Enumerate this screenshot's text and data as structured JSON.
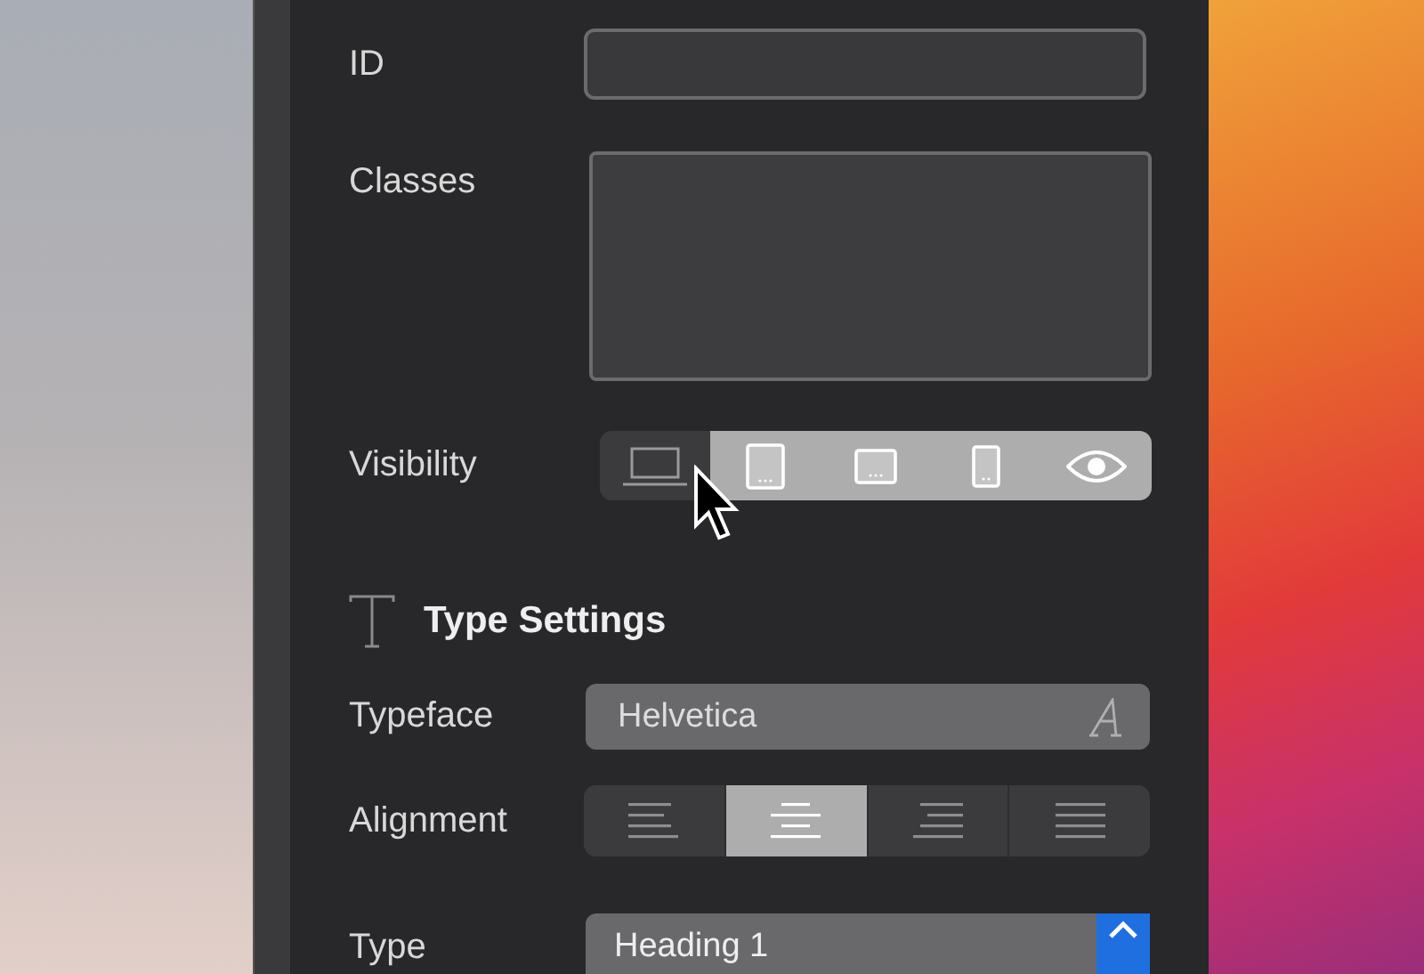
{
  "fields": [
    {
      "label": "ID",
      "kind": "input"
    },
    {
      "label": "Classes",
      "kind": "textarea"
    }
  ],
  "visibility": {
    "label": "Visibility",
    "devices": [
      {
        "kind": "laptop",
        "on": false
      },
      {
        "kind": "tablet",
        "on": true
      },
      {
        "kind": "landscape",
        "on": true
      },
      {
        "kind": "phone",
        "on": true
      },
      {
        "kind": "eye",
        "on": true
      }
    ]
  },
  "type_settings": {
    "title": "Type Settings",
    "typeface": {
      "label": "Typeface",
      "value": "Helvetica"
    },
    "alignment": {
      "label": "Alignment",
      "options": [
        {
          "kind": "left",
          "selected": false
        },
        {
          "kind": "center",
          "selected": true
        },
        {
          "kind": "right",
          "selected": false
        },
        {
          "kind": "justify",
          "selected": false
        }
      ]
    },
    "type": {
      "label": "Type",
      "value": "Heading 1"
    }
  }
}
